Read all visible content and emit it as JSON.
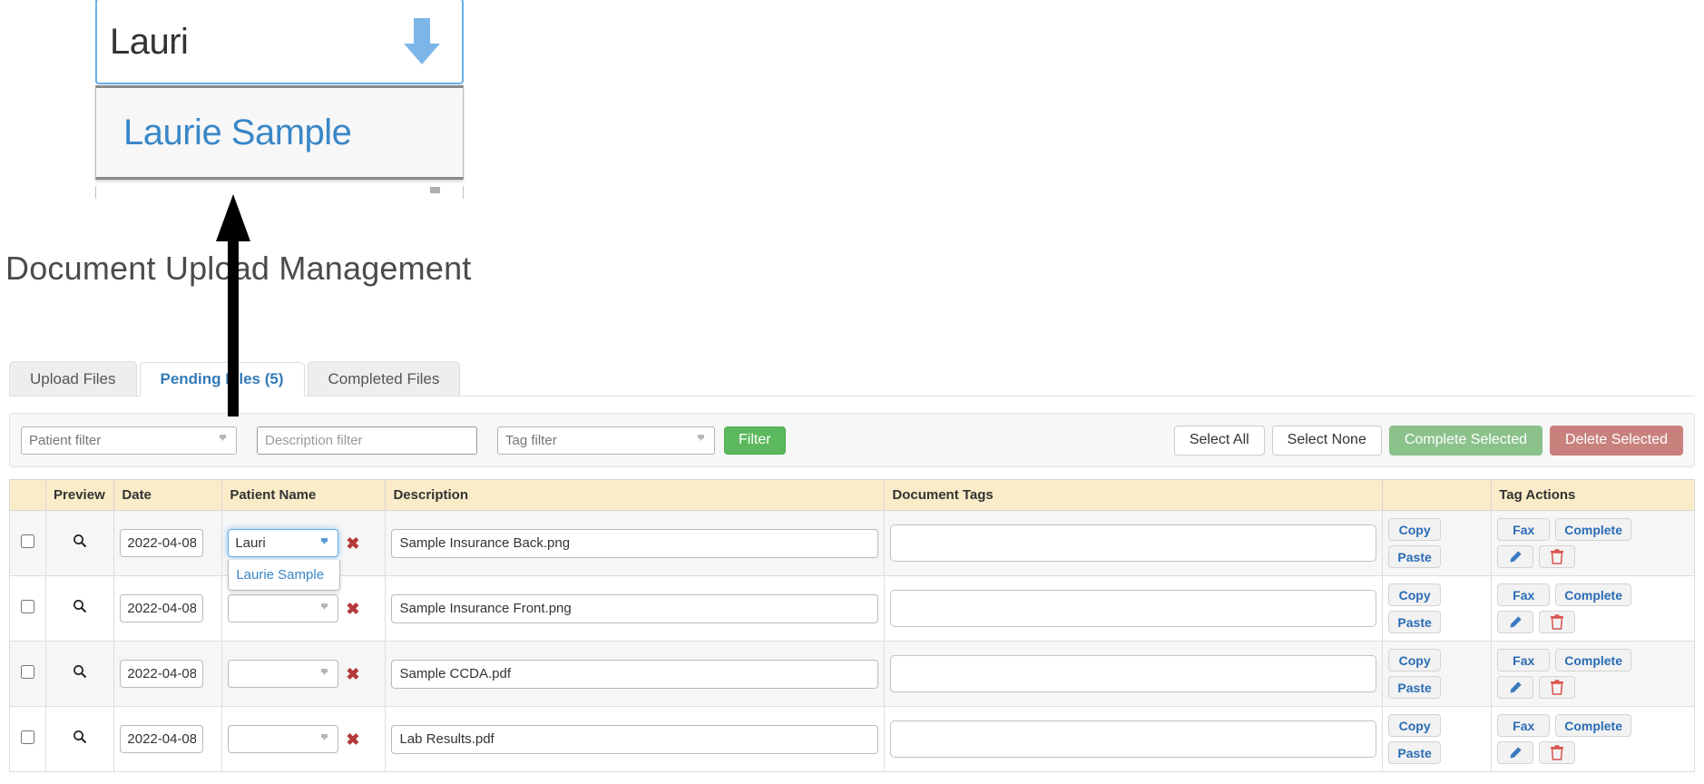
{
  "callout": {
    "field_value": "Lauri",
    "dropdown_option": "Laurie Sample",
    "arrow_icon": "arrow-down-icon",
    "resize_grip_icon": "resize-grip-icon"
  },
  "annotation": {
    "pointer_icon": "upward-pointer-arrow-icon"
  },
  "header": {
    "title": "Document Upload Management"
  },
  "tabs": [
    {
      "label": "Upload Files",
      "active": false
    },
    {
      "label": "Pending Files (5)",
      "active": true
    },
    {
      "label": "Completed Files",
      "active": false
    }
  ],
  "filters": {
    "patient_placeholder": "Patient filter",
    "patient_value": "",
    "description_placeholder": "Description filter",
    "description_value": "",
    "tag_placeholder": "Tag filter",
    "tag_value": "",
    "filter_button": "Filter",
    "select_all": "Select All",
    "select_none": "Select None",
    "complete_selected": "Complete Selected",
    "delete_selected": "Delete Selected"
  },
  "table": {
    "columns": [
      {
        "key": "check",
        "label": ""
      },
      {
        "key": "preview",
        "label": "Preview"
      },
      {
        "key": "date",
        "label": "Date"
      },
      {
        "key": "patient",
        "label": "Patient Name"
      },
      {
        "key": "description",
        "label": "Description"
      },
      {
        "key": "tags",
        "label": "Document Tags"
      },
      {
        "key": "copypaste",
        "label": ""
      },
      {
        "key": "actions",
        "label": "Tag Actions"
      }
    ],
    "row_buttons": {
      "copy": "Copy",
      "paste": "Paste",
      "fax": "Fax",
      "complete": "Complete",
      "edit_icon": "pencil-icon",
      "delete_icon": "trash-icon",
      "preview_icon": "magnifier-icon",
      "remove_patient_icon": "red-x-icon",
      "select_caret_icon": "chevron-down-icon"
    },
    "rows": [
      {
        "checked": false,
        "date": "2022-04-08",
        "patient": "Lauri",
        "patient_focused": true,
        "patient_menu": [
          "Laurie Sample"
        ],
        "description": "Sample Insurance Back.png",
        "tags": ""
      },
      {
        "checked": false,
        "date": "2022-04-08",
        "patient": "",
        "patient_focused": false,
        "patient_menu": [],
        "description": "Sample Insurance Front.png",
        "tags": ""
      },
      {
        "checked": false,
        "date": "2022-04-08",
        "patient": "",
        "patient_focused": false,
        "patient_menu": [],
        "description": "Sample CCDA.pdf",
        "tags": ""
      },
      {
        "checked": false,
        "date": "2022-04-08",
        "patient": "",
        "patient_focused": false,
        "patient_menu": [],
        "description": "Lab Results.pdf",
        "tags": ""
      }
    ]
  },
  "colors": {
    "accent_blue": "#337ab7",
    "link_blue": "#2a6cb5",
    "focus_blue": "#66afe9",
    "header_cream": "#faecc8",
    "success_green": "#8bc28b",
    "filter_green": "#5cb85c",
    "danger_red": "#c9817e",
    "x_red": "#b33a3a",
    "trash_red": "#d9534f"
  }
}
